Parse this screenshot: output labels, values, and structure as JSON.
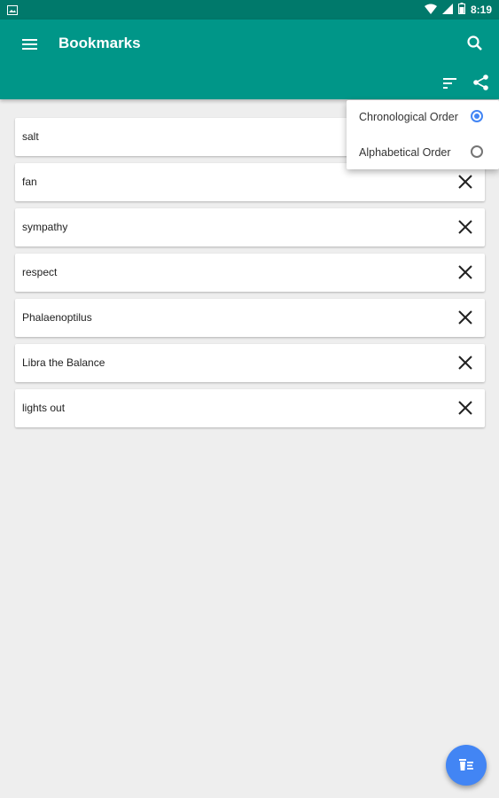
{
  "status_bar": {
    "time": "8:19",
    "icons": [
      "image-icon",
      "wifi-icon",
      "signal-icon",
      "battery-icon"
    ]
  },
  "app_bar": {
    "title": "Bookmarks",
    "icons": [
      "menu-icon",
      "search-icon",
      "sort-icon",
      "share-icon"
    ],
    "color": "#009688"
  },
  "bookmarks": [
    {
      "label": "salt"
    },
    {
      "label": "fan"
    },
    {
      "label": "sympathy"
    },
    {
      "label": "respect"
    },
    {
      "label": "Phalaenoptilus"
    },
    {
      "label": "Libra the Balance"
    },
    {
      "label": "lights out"
    }
  ],
  "sort_menu": {
    "options": [
      {
        "label": "Chronological Order",
        "selected": true
      },
      {
        "label": "Alphabetical Order",
        "selected": false
      }
    ]
  },
  "fab": {
    "icon": "delete-all-icon",
    "color": "#4285f4"
  }
}
